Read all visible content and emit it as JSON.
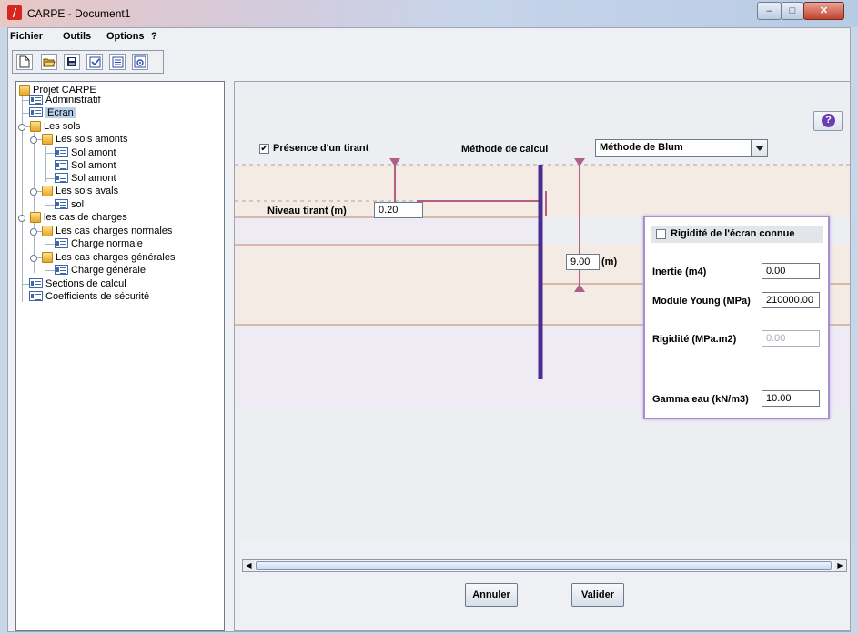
{
  "window": {
    "title": "CARPE - Document1",
    "app_icon": "carpe-logo-icon"
  },
  "menu": {
    "items": [
      "Fichier",
      "Outils",
      "Options",
      "?"
    ]
  },
  "toolbar": {
    "icons": [
      "new-document-icon",
      "open-folder-icon",
      "save-icon",
      "check-icon",
      "list-icon",
      "settings-icon"
    ]
  },
  "tree": {
    "nodes": [
      {
        "label": "Projet CARPE"
      },
      {
        "label": "Administratif"
      },
      {
        "label": "Ecran"
      },
      {
        "label": "Les sols"
      },
      {
        "label": "Les sols amonts"
      },
      {
        "label": "Sol amont"
      },
      {
        "label": "Sol amont"
      },
      {
        "label": "Sol amont"
      },
      {
        "label": "Les sols avals"
      },
      {
        "label": "sol"
      },
      {
        "label": "les cas de charges"
      },
      {
        "label": "Les cas charges normales"
      },
      {
        "label": "Charge normale"
      },
      {
        "label": "Les cas charges générales"
      },
      {
        "label": "Charge générale"
      },
      {
        "label": "Sections de calcul"
      },
      {
        "label": "Coefficients de sécurité"
      }
    ]
  },
  "form": {
    "tirant_label": "Présence d'un tirant",
    "tirant_checked": true,
    "check_mark": "✔",
    "method_label": "Méthode de calcul",
    "method_value": "Méthode de Blum",
    "niveau_label": "Niveau tirant (m)",
    "niveau_value": "0.20",
    "height_value": "9.00",
    "height_unit": "(m)"
  },
  "stiffness": {
    "header_label": "Rigidité de l'écran connue",
    "header_checked": false,
    "inertie_label": "Inertie (m4)",
    "inertie_value": "0.00",
    "young_label": "Module Young (MPa)",
    "young_value": "210000.00",
    "rigidite_label": "Rigidité (MPa.m2)",
    "rigidite_value": "0.00",
    "gamma_label": "Gamma eau (kN/m3)",
    "gamma_value": "10.00"
  },
  "buttons": {
    "cancel": "Annuler",
    "validate": "Valider"
  },
  "colors": {
    "soil_upper": "#f3ebe4",
    "soil_lower": "#efebf5",
    "layer_line": "#b98a6a",
    "wall": "#4b2d92",
    "marker": "#b25f85",
    "dialog_border": "#a78fd2"
  }
}
